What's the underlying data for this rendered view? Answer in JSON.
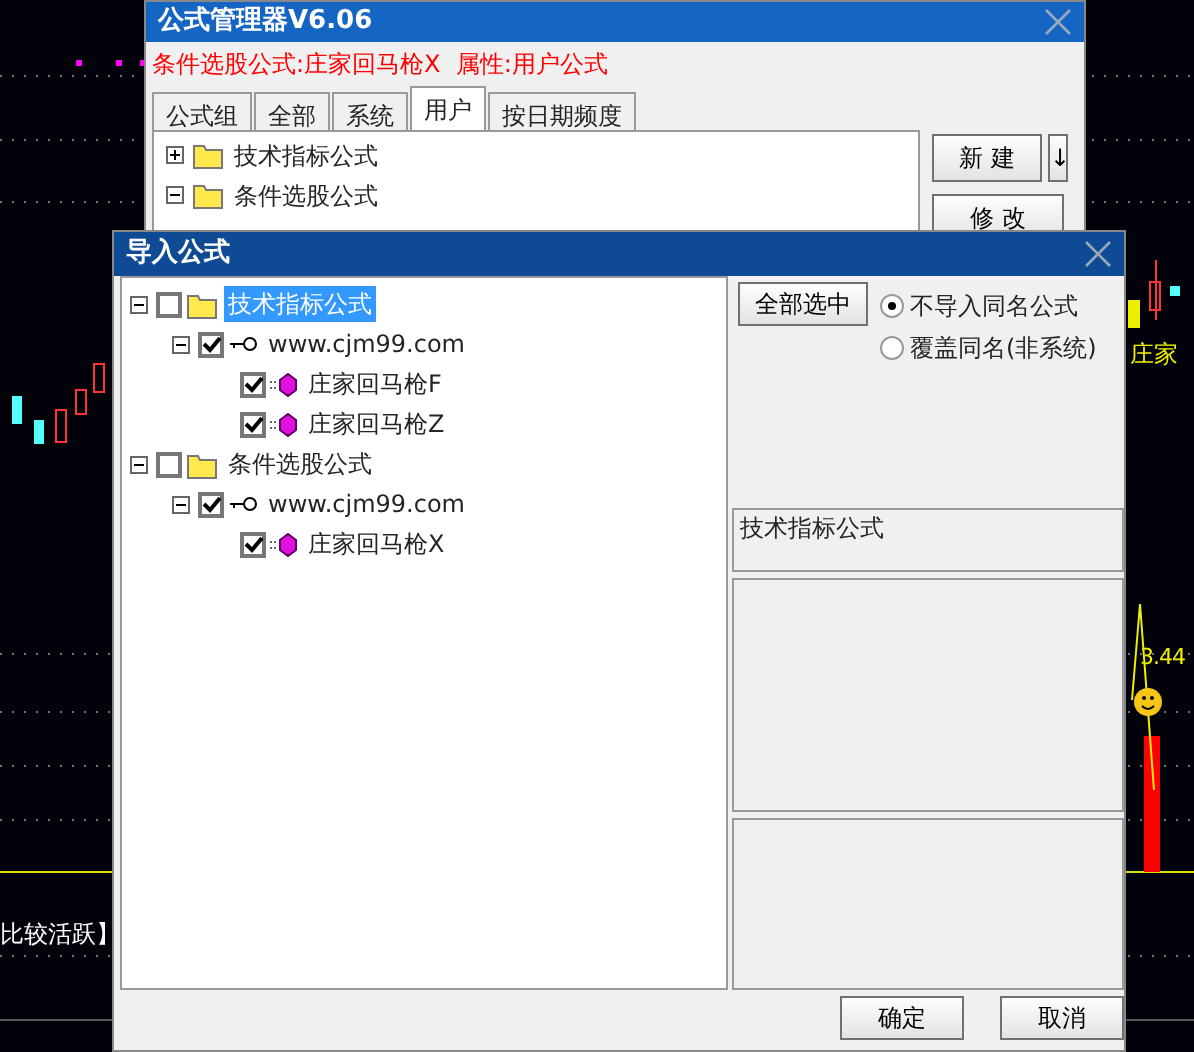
{
  "chart": {
    "labels": [
      {
        "kind": "signal",
        "text": "庄家"
      },
      {
        "kind": "price",
        "text": "3.44"
      },
      {
        "kind": "note",
        "text": "比较活跃】"
      }
    ]
  },
  "manager": {
    "title": "公式管理器V6.06",
    "status": "条件选股公式:庄家回马枪X  属性:用户公式",
    "tabs": [
      {
        "label": "公式组",
        "selected": false
      },
      {
        "label": "全部",
        "selected": false
      },
      {
        "label": "系统",
        "selected": false
      },
      {
        "label": "用户",
        "selected": true
      },
      {
        "label": "按日期频度",
        "selected": false
      }
    ],
    "tree": [
      {
        "label": "技术指标公式",
        "expanded": false
      },
      {
        "label": "条件选股公式",
        "expanded": true
      }
    ],
    "buttons": [
      {
        "kind": "new",
        "label": "新 建"
      },
      {
        "kind": "arrow",
        "label": "↓"
      },
      {
        "kind": "edit",
        "label": "修 改"
      }
    ]
  },
  "import_dialog": {
    "title": "导入公式",
    "tree": [
      {
        "kind": "group",
        "label": "技术指标公式",
        "checked": false,
        "selected": true,
        "expanded": true,
        "children": [
          {
            "kind": "package",
            "label": "www.cjm99.com",
            "checked": true,
            "selected": false,
            "expanded": true,
            "children": [
              {
                "kind": "formula",
                "label": "庄家回马枪F",
                "checked": true,
                "selected": false
              },
              {
                "kind": "formula",
                "label": "庄家回马枪Z",
                "checked": true,
                "selected": false
              }
            ]
          }
        ]
      },
      {
        "kind": "group",
        "label": "条件选股公式",
        "checked": false,
        "selected": false,
        "expanded": true,
        "children": [
          {
            "kind": "package",
            "label": "www.cjm99.com",
            "checked": true,
            "selected": false,
            "expanded": true,
            "children": [
              {
                "kind": "formula",
                "label": "庄家回马枪X",
                "checked": true,
                "selected": false
              }
            ]
          }
        ]
      }
    ],
    "select_all": "全部选中",
    "options": [
      {
        "label": "不导入同名公式",
        "selected": true
      },
      {
        "label": "覆盖同名(非系统)",
        "selected": false
      }
    ],
    "info": "技术指标公式",
    "buttons": [
      "确定",
      "取消"
    ]
  }
}
